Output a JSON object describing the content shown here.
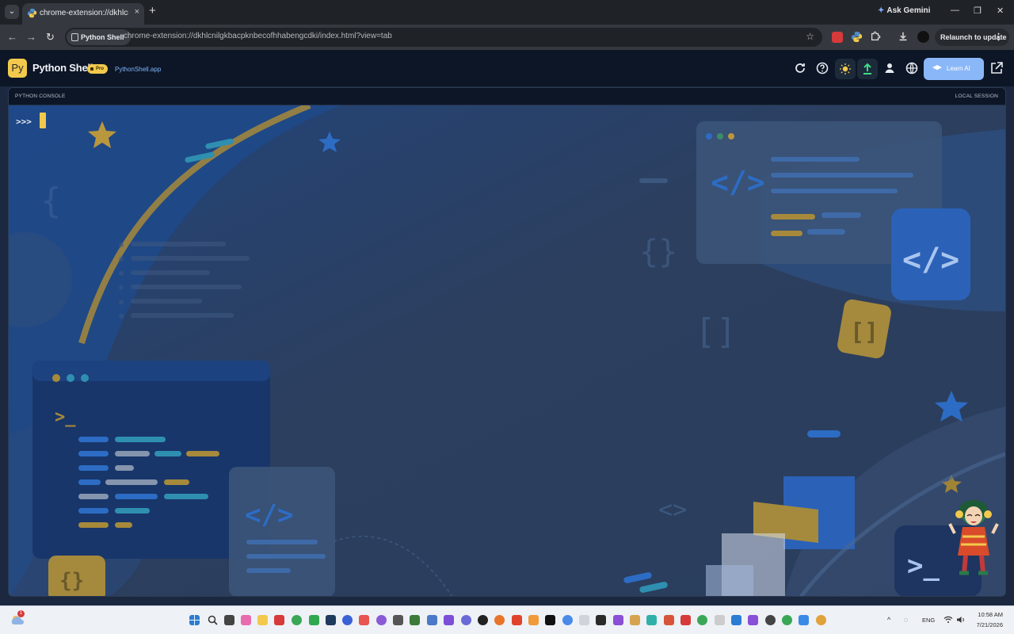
{
  "browser": {
    "tab_title": "chrome-extension://dkhlcnilgk",
    "tab_close": "×",
    "new_tab": "+",
    "ask_gemini": "Ask Gemini",
    "site_chip": "Python Shell",
    "url": "chrome-extension://dkhlcnilgkbacpknbecofhhabengcdki/index.html?view=tab",
    "relaunch_label": "Relaunch to update",
    "tab_menu": "⌄",
    "nav_back": "←",
    "nav_forward": "→",
    "nav_reload": "↻",
    "star": "☆",
    "menu_dots": "⋮",
    "window_controls": {
      "minimize": "—",
      "maximize": "❐",
      "close": "✕"
    },
    "extension_colors": [
      "#d63a3a",
      "#f2c94c",
      "#e0e0e0",
      "#e0e0e0",
      "#111111"
    ]
  },
  "app": {
    "logo_text": "Py",
    "title": "Python Shell",
    "pro_badge": "Pro",
    "link": "PythonShell.app",
    "learn_ai": "Learn AI",
    "icons": [
      "refresh-icon",
      "help-icon",
      "sun-icon",
      "upload-icon",
      "user-icon",
      "globe-icon",
      "open-external-icon"
    ],
    "accent_color": "#f2c94c",
    "learn_ai_color": "#8ab7f7"
  },
  "console": {
    "label": "PYTHON CONSOLE",
    "session": "LOCAL SESSION",
    "prompt": ">>>"
  },
  "taskbar": {
    "weather_badge": "1",
    "language": "ENG",
    "time": "10:58 AM",
    "date": "7/21/2026"
  }
}
